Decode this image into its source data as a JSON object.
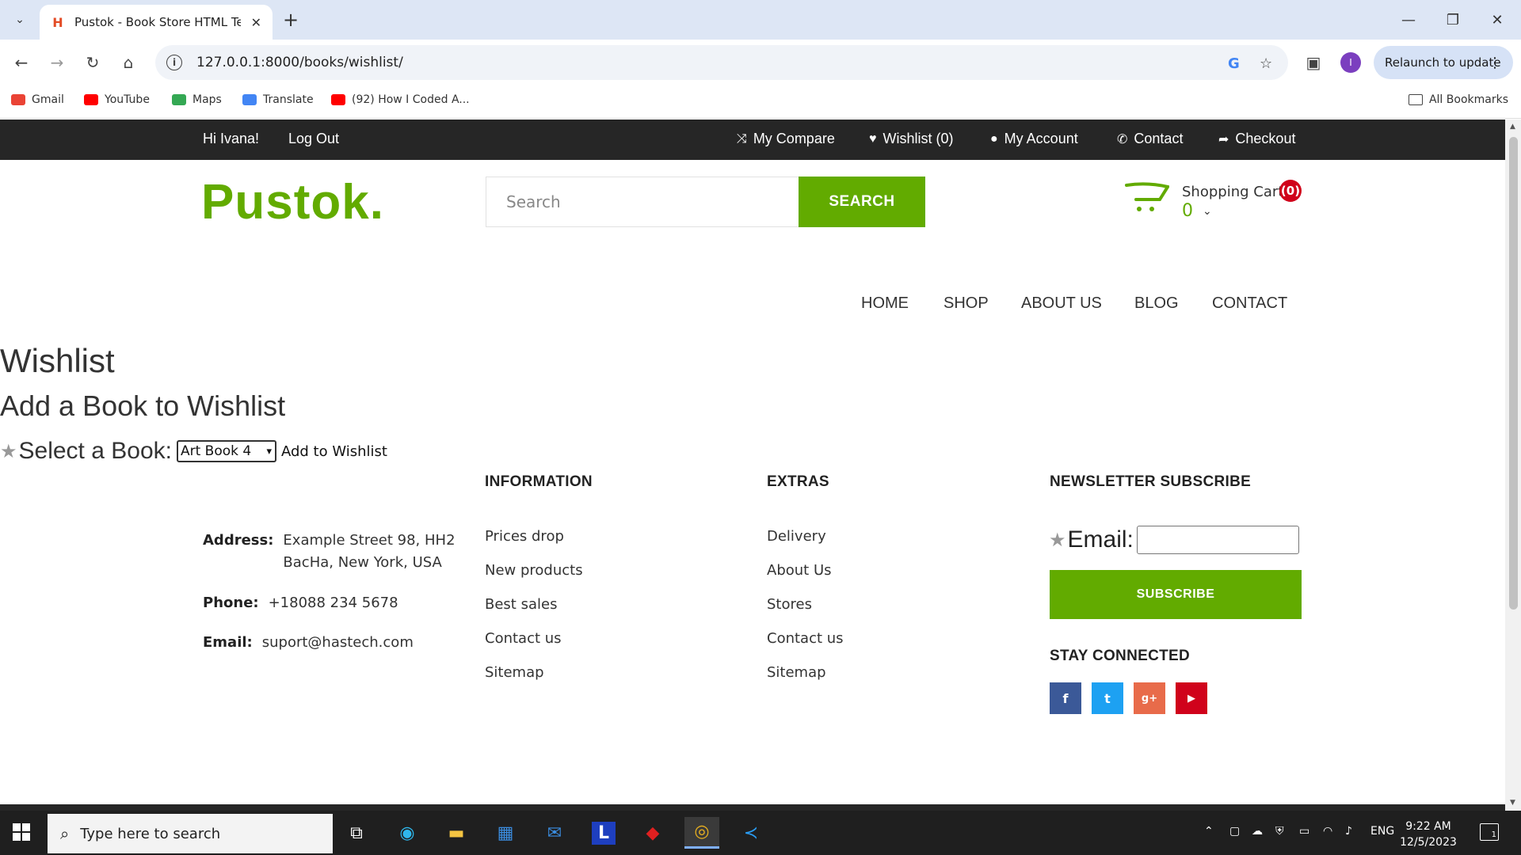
{
  "browser": {
    "tab_title": "Pustok - Book Store HTML Tem",
    "url": "127.0.0.1:8000/books/wishlist/",
    "relaunch_label": "Relaunch to update",
    "profile_initial": "I",
    "bookmarks": [
      {
        "label": "Gmail",
        "color": "#ea4335"
      },
      {
        "label": "YouTube",
        "color": "#ff0000"
      },
      {
        "label": "Maps",
        "color": "#34a853"
      },
      {
        "label": "Translate",
        "color": "#4285f4"
      },
      {
        "label": "(92) How I Coded A...",
        "color": "#ff0000"
      }
    ],
    "all_bookmarks": "All Bookmarks"
  },
  "topbar": {
    "greeting": "Hi Ivana!",
    "logout": "Log Out",
    "compare": "My Compare",
    "wishlist": "Wishlist (0)",
    "account": "My Account",
    "contact": "Contact",
    "checkout": "Checkout"
  },
  "header": {
    "logo": "Pustok.",
    "search_placeholder": "Search",
    "search_button": "SEARCH",
    "cart_title": "Shopping Cart",
    "cart_count": "(0)",
    "cart_total": "0"
  },
  "nav": [
    "HOME",
    "SHOP",
    "ABOUT US",
    "BLOG",
    "CONTACT"
  ],
  "main": {
    "title": "Wishlist",
    "subtitle": "Add a Book to Wishlist",
    "select_label": "Select a Book:",
    "selected_book": "Art Book 4",
    "add_button": "Add to Wishlist"
  },
  "footer": {
    "address_label": "Address:",
    "address_line1": "Example Street 98, HH2",
    "address_line2": "BacHa, New York, USA",
    "phone_label": "Phone:",
    "phone": "+18088 234 5678",
    "email_label": "Email:",
    "email": "suport@hastech.com",
    "information_heading": "INFORMATION",
    "information_links": [
      "Prices drop",
      "New products",
      "Best sales",
      "Contact us",
      "Sitemap"
    ],
    "extras_heading": "EXTRAS",
    "extras_links": [
      "Delivery",
      "About Us",
      "Stores",
      "Contact us",
      "Sitemap"
    ],
    "newsletter_heading": "NEWSLETTER SUBSCRIBE",
    "newsletter_label": "Email:",
    "subscribe_button": "SUBSCRIBE",
    "stay_connected": "STAY CONNECTED",
    "social": [
      {
        "icon": "f",
        "name": "facebook",
        "color": "#3b5998"
      },
      {
        "icon": "t",
        "name": "twitter",
        "color": "#1da1f2"
      },
      {
        "icon": "g+",
        "name": "google-plus",
        "color": "#e86b4a"
      },
      {
        "icon": "▶",
        "name": "youtube",
        "color": "#d0021b"
      }
    ]
  },
  "taskbar": {
    "search_placeholder": "Type here to search",
    "language": "ENG",
    "time": "9:22 AM",
    "date": "12/5/2023",
    "notification_count": "1"
  },
  "colors": {
    "brand_green": "#62ab00",
    "topbar_dark": "#262626",
    "badge_red": "#d0021b"
  }
}
